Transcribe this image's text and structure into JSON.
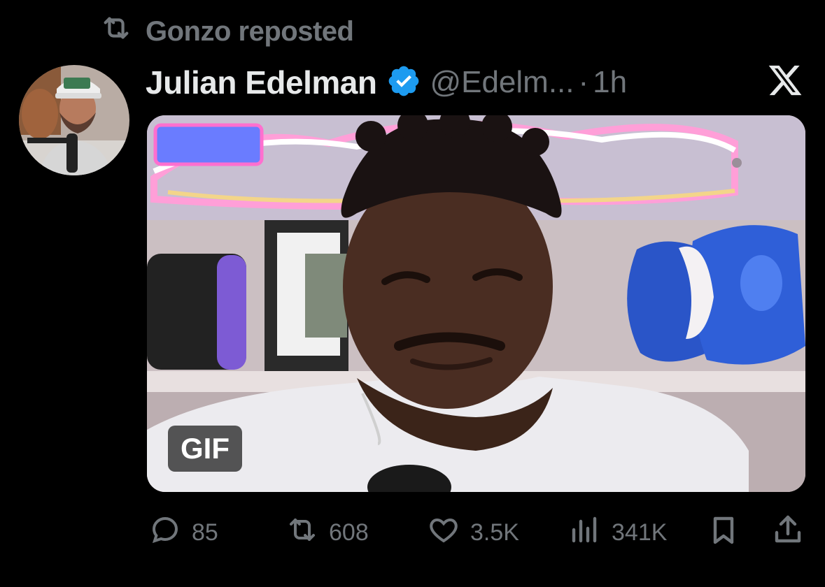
{
  "repost_header": {
    "text": "Gonzo reposted",
    "icon": "repost-icon"
  },
  "author": {
    "display_name": "Julian Edelman",
    "verified": true,
    "handle": "@Edelm...",
    "separator": "·",
    "time": "1h",
    "avatar_icon": "avatar-photo"
  },
  "platform_logo": "x-logo",
  "media": {
    "badge": "GIF",
    "type": "animated-gif"
  },
  "actions": {
    "replies": "85",
    "reposts": "608",
    "likes": "3.5K",
    "views": "341K"
  },
  "colors": {
    "background": "#000000",
    "primary_text": "#e7e9ea",
    "secondary_text": "#71767b",
    "verified_badge": "#1d9bf0"
  }
}
